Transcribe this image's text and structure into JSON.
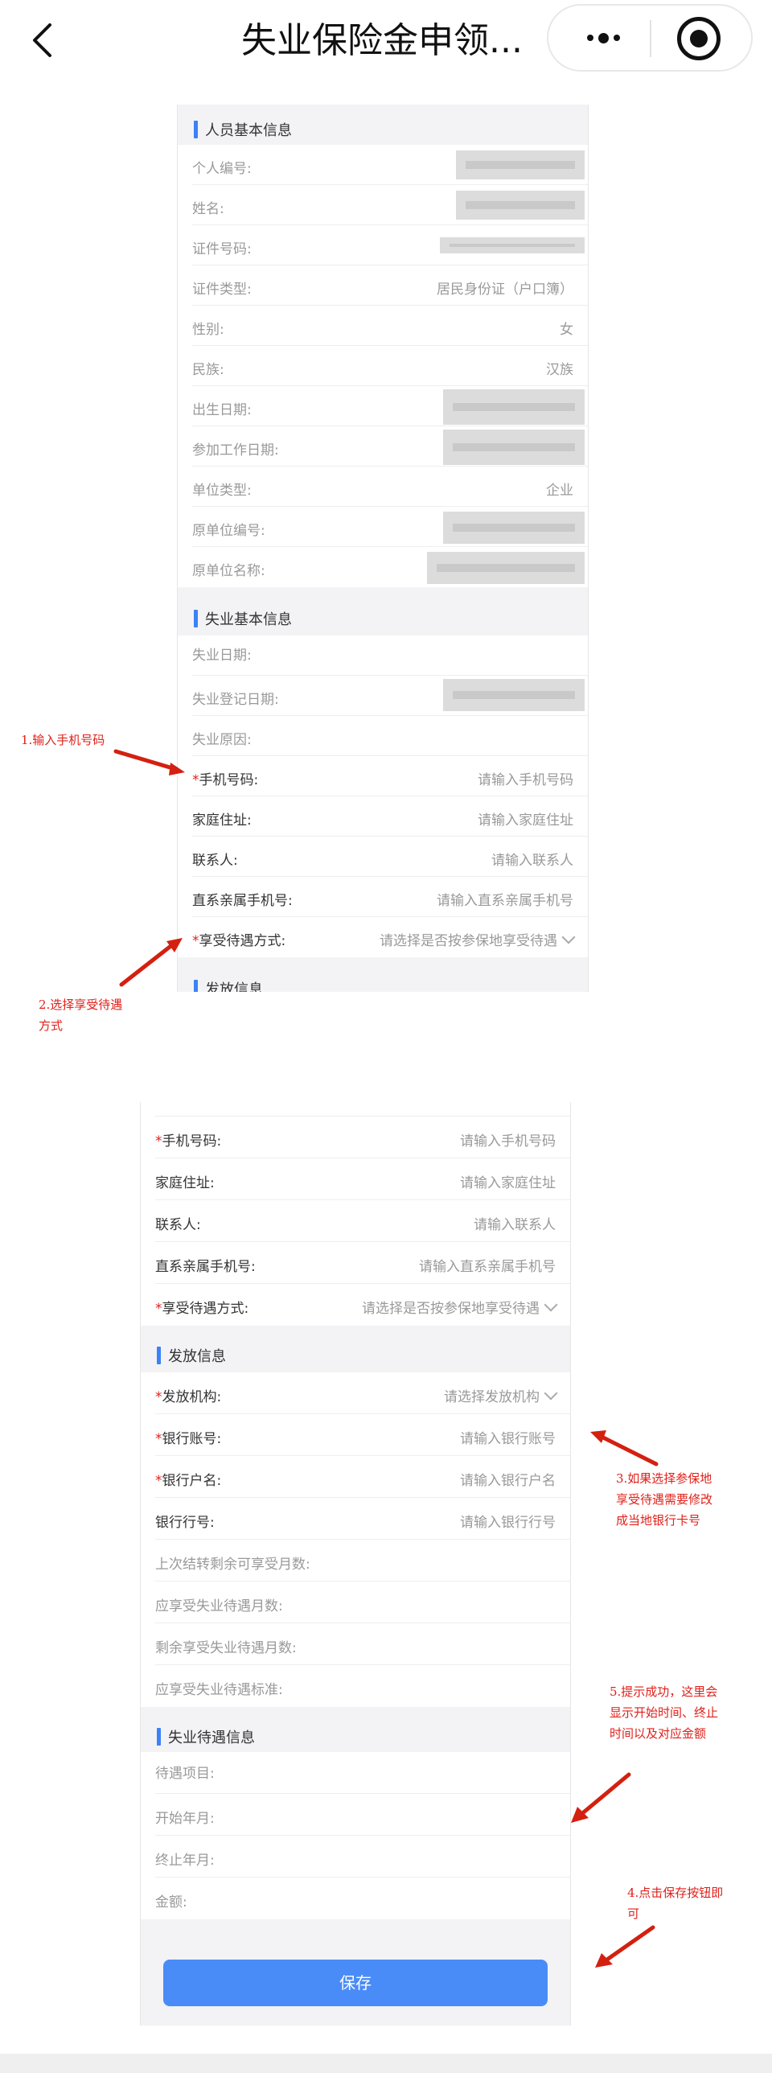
{
  "nav": {
    "title": "失业保险金申领..."
  },
  "panel1": {
    "section_personal": "人员基本信息",
    "personal_rows": [
      {
        "label": "个人编号:",
        "value": "",
        "masked": true
      },
      {
        "label": "姓名:",
        "value": "",
        "masked": true
      },
      {
        "label": "证件号码:",
        "value": "",
        "masked": true
      },
      {
        "label": "证件类型:",
        "value": "居民身份证（户口簿）",
        "masked": false
      },
      {
        "label": "性别:",
        "value": "女",
        "masked": false
      },
      {
        "label": "民族:",
        "value": "汉族",
        "masked": false
      },
      {
        "label": "出生日期:",
        "value": "",
        "masked": true
      },
      {
        "label": "参加工作日期:",
        "value": "",
        "masked": true
      },
      {
        "label": "单位类型:",
        "value": "企业",
        "masked": false
      },
      {
        "label": "原单位编号:",
        "value": "",
        "masked": true
      },
      {
        "label": "原单位名称:",
        "value": "",
        "masked": true
      }
    ],
    "section_unemp": "失业基本信息",
    "unemp_rows": [
      {
        "label": "失业日期:",
        "value": ""
      },
      {
        "label": "失业登记日期:",
        "value": ""
      },
      {
        "label": "失业原因:",
        "value": ""
      }
    ],
    "phone_label": "手机号码:",
    "phone_placeholder": "请输入手机号码",
    "address_label": "家庭住址:",
    "address_placeholder": "请输入家庭住址",
    "contact_label": "联系人:",
    "contact_placeholder": "请输入联系人",
    "relative_label": "直系亲属手机号:",
    "relative_placeholder": "请输入直系亲属手机号",
    "benefit_label": "享受待遇方式:",
    "benefit_placeholder": "请选择是否按参保地享受待遇",
    "section_payout_cut": "发放信息"
  },
  "panel2": {
    "phone_label": "手机号码:",
    "phone_placeholder": "请输入手机号码",
    "address_label": "家庭住址:",
    "address_placeholder": "请输入家庭住址",
    "contact_label": "联系人:",
    "contact_placeholder": "请输入联系人",
    "relative_label": "直系亲属手机号:",
    "relative_placeholder": "请输入直系亲属手机号",
    "benefit_label": "享受待遇方式:",
    "benefit_placeholder": "请选择是否按参保地享受待遇",
    "section_payout": "发放信息",
    "org_label": "发放机构:",
    "org_placeholder": "请选择发放机构",
    "account_label": "银行账号:",
    "account_placeholder": "请输入银行账号",
    "account_name_label": "银行户名:",
    "account_name_placeholder": "请输入银行户名",
    "bank_code_label": "银行行号:",
    "bank_code_placeholder": "请输入银行行号",
    "months_last_label": "上次结转剩余可享受月数:",
    "months_due_label": "应享受失业待遇月数:",
    "months_remain_label": "剩余享受失业待遇月数:",
    "standard_label": "应享受失业待遇标准:",
    "section_benefit": "失业待遇信息",
    "item_label": "待遇项目:",
    "start_label": "开始年月:",
    "end_label": "终止年月:",
    "amount_label": "金额:",
    "save_label": "保存"
  },
  "annotations": {
    "a1": "1.输入手机号码",
    "a2_l1": "2.选择享受待遇",
    "a2_l2": "方式",
    "a3_l1": "3.如果选择参保地",
    "a3_l2": "享受待遇需要修改",
    "a3_l3": "成当地银行卡号",
    "a4_l1": "4.点击保存按钮即",
    "a4_l2": "可",
    "a5_l1": "5.提示成功，这里会",
    "a5_l2": "显示开始时间、终止",
    "a5_l3": "时间以及对应金额"
  },
  "colors": {
    "accent": "#4a8cf7",
    "required": "#e02020",
    "annotation": "#e0201a"
  },
  "icons": {
    "back": "chevron-left-icon",
    "more": "more-dots-icon",
    "target": "target-icon",
    "dropdown": "chevron-down-icon"
  }
}
